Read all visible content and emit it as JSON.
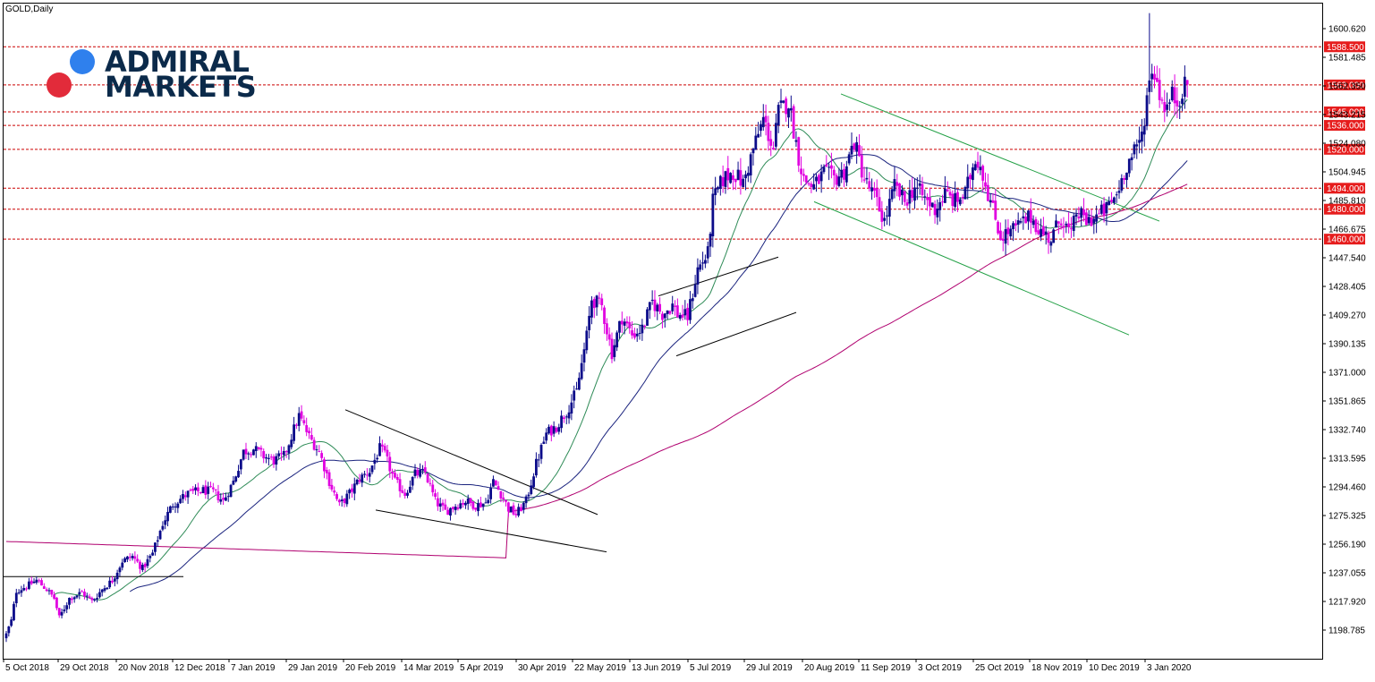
{
  "title": "GOLD,Daily",
  "logo": {
    "line1": "ADMIRAL",
    "line2": "MARKETS",
    "dot_blue": "#2f80ed",
    "dot_red": "#e22b3a",
    "text_color": "#0b2a4a"
  },
  "colors": {
    "bull": "#0b0b8a",
    "bear": "#e000e0",
    "ma_green": "#2e8b57",
    "ma_blue": "#1a237e",
    "ma_magenta": "#b0006f",
    "hline": "#cc0000",
    "label_bg": "#e61c1c",
    "trend": "#000000",
    "channel": "#22a045"
  },
  "chart_data": {
    "type": "candlestick",
    "symbol": "GOLD",
    "timeframe": "Daily",
    "ylim": [
      1185,
      1620
    ],
    "y_ticks": [
      "1600.620",
      "1581.485",
      "1562.350",
      "1543.215",
      "1524.080",
      "1504.945",
      "1485.810",
      "1466.675",
      "1447.540",
      "1428.405",
      "1409.270",
      "1390.135",
      "1371.000",
      "1351.865",
      "1332.740",
      "1313.595",
      "1294.460",
      "1275.325",
      "1256.190",
      "1237.055",
      "1217.920",
      "1198.785"
    ],
    "x_labels": [
      "5 Oct 2018",
      "29 Oct 2018",
      "20 Nov 2018",
      "12 Dec 2018",
      "7 Jan 2019",
      "29 Jan 2019",
      "20 Feb 2019",
      "14 Mar 2019",
      "5 Apr 2019",
      "30 Apr 2019",
      "22 May 2019",
      "13 Jun 2019",
      "5 Jul 2019",
      "29 Jul 2019",
      "20 Aug 2019",
      "11 Sep 2019",
      "3 Oct 2019",
      "25 Oct 2019",
      "18 Nov 2019",
      "10 Dec 2019",
      "3 Jan 2020"
    ],
    "horizontal_levels": [
      "1588.500",
      "1563.000",
      "1545.000",
      "1536.000",
      "1520.000",
      "1494.000",
      "1480.000",
      "1460.000"
    ],
    "close_anchors": [
      [
        0,
        1196
      ],
      [
        2,
        1205
      ],
      [
        4,
        1225
      ],
      [
        8,
        1228
      ],
      [
        12,
        1232
      ],
      [
        16,
        1226
      ],
      [
        19,
        1220
      ],
      [
        21,
        1207
      ],
      [
        25,
        1220
      ],
      [
        30,
        1224
      ],
      [
        34,
        1218
      ],
      [
        38,
        1226
      ],
      [
        42,
        1232
      ],
      [
        46,
        1245
      ],
      [
        50,
        1248
      ],
      [
        54,
        1240
      ],
      [
        58,
        1250
      ],
      [
        62,
        1270
      ],
      [
        66,
        1283
      ],
      [
        72,
        1290
      ],
      [
        78,
        1292
      ],
      [
        82,
        1291
      ],
      [
        86,
        1285
      ],
      [
        90,
        1298
      ],
      [
        94,
        1318
      ],
      [
        98,
        1320
      ],
      [
        102,
        1315
      ],
      [
        106,
        1312
      ],
      [
        110,
        1315
      ],
      [
        114,
        1333
      ],
      [
        116,
        1342
      ],
      [
        120,
        1328
      ],
      [
        124,
        1318
      ],
      [
        128,
        1298
      ],
      [
        132,
        1282
      ],
      [
        136,
        1290
      ],
      [
        140,
        1300
      ],
      [
        144,
        1305
      ],
      [
        148,
        1320
      ],
      [
        150,
        1316
      ],
      [
        154,
        1298
      ],
      [
        158,
        1290
      ],
      [
        162,
        1303
      ],
      [
        166,
        1304
      ],
      [
        170,
        1285
      ],
      [
        174,
        1278
      ],
      [
        178,
        1282
      ],
      [
        182,
        1285
      ],
      [
        186,
        1282
      ],
      [
        190,
        1284
      ],
      [
        193,
        1298
      ],
      [
        196,
        1290
      ],
      [
        199,
        1280
      ],
      [
        202,
        1276
      ],
      [
        206,
        1285
      ],
      [
        210,
        1310
      ],
      [
        214,
        1330
      ],
      [
        218,
        1335
      ],
      [
        222,
        1345
      ],
      [
        226,
        1358
      ],
      [
        230,
        1395
      ],
      [
        232,
        1420
      ],
      [
        236,
        1415
      ],
      [
        240,
        1384
      ],
      [
        244,
        1408
      ],
      [
        248,
        1396
      ],
      [
        252,
        1400
      ],
      [
        256,
        1418
      ],
      [
        260,
        1410
      ],
      [
        264,
        1416
      ],
      [
        266,
        1410
      ],
      [
        270,
        1408
      ],
      [
        274,
        1440
      ],
      [
        278,
        1450
      ],
      [
        280,
        1485
      ],
      [
        284,
        1500
      ],
      [
        288,
        1505
      ],
      [
        292,
        1497
      ],
      [
        296,
        1520
      ],
      [
        300,
        1540
      ],
      [
        304,
        1520
      ],
      [
        306,
        1545
      ],
      [
        310,
        1552
      ],
      [
        314,
        1515
      ],
      [
        316,
        1500
      ],
      [
        320,
        1495
      ],
      [
        324,
        1504
      ],
      [
        328,
        1500
      ],
      [
        332,
        1505
      ],
      [
        336,
        1525
      ],
      [
        340,
        1500
      ],
      [
        344,
        1488
      ],
      [
        348,
        1472
      ],
      [
        352,
        1495
      ],
      [
        356,
        1485
      ],
      [
        360,
        1495
      ],
      [
        364,
        1487
      ],
      [
        368,
        1480
      ],
      [
        372,
        1490
      ],
      [
        376,
        1485
      ],
      [
        380,
        1490
      ],
      [
        384,
        1515
      ],
      [
        386,
        1510
      ],
      [
        390,
        1485
      ],
      [
        394,
        1462
      ],
      [
        398,
        1465
      ],
      [
        402,
        1470
      ],
      [
        406,
        1475
      ],
      [
        410,
        1465
      ],
      [
        414,
        1460
      ],
      [
        418,
        1475
      ],
      [
        422,
        1462
      ],
      [
        424,
        1478
      ],
      [
        428,
        1472
      ],
      [
        432,
        1475
      ],
      [
        436,
        1480
      ],
      [
        440,
        1490
      ],
      [
        444,
        1510
      ],
      [
        448,
        1520
      ],
      [
        450,
        1530
      ],
      [
        452,
        1555
      ],
      [
        454,
        1575
      ],
      [
        456,
        1565
      ],
      [
        458,
        1552
      ],
      [
        460,
        1548
      ],
      [
        462,
        1556
      ],
      [
        464,
        1552
      ],
      [
        466,
        1560
      ],
      [
        468,
        1563
      ]
    ]
  }
}
